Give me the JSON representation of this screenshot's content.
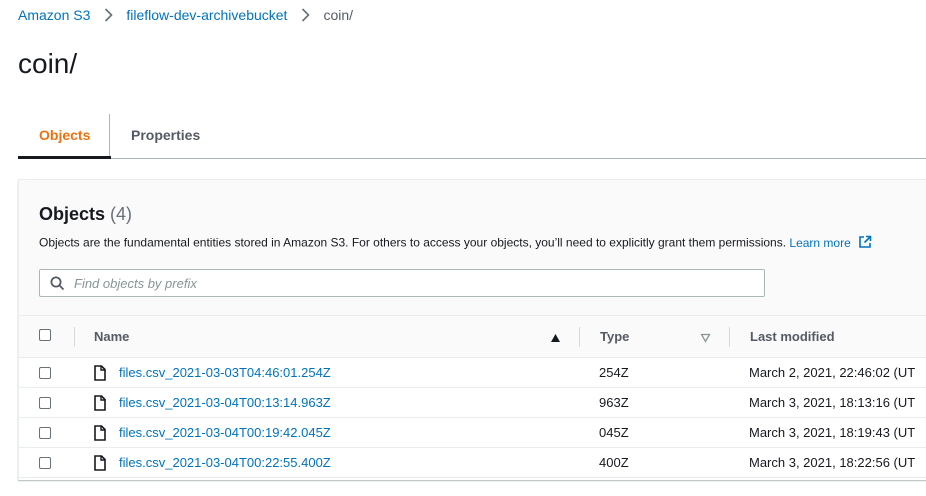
{
  "breadcrumb": {
    "items": [
      {
        "label": "Amazon S3"
      },
      {
        "label": "fileflow-dev-archivebucket"
      }
    ],
    "current": "coin/"
  },
  "page": {
    "title": "coin/"
  },
  "tabs": [
    {
      "label": "Objects",
      "active": true
    },
    {
      "label": "Properties",
      "active": false
    }
  ],
  "objects_panel": {
    "title": "Objects",
    "count": "(4)",
    "description": "Objects are the fundamental entities stored in Amazon S3. For others to access your objects, you’ll need to explicitly grant them permissions.",
    "learn_more": "Learn more",
    "search": {
      "placeholder": "Find objects by prefix",
      "value": ""
    },
    "columns": {
      "name": "Name",
      "type": "Type",
      "last_modified": "Last modified"
    },
    "rows": [
      {
        "name": "files.csv_2021-03-03T04:46:01.254Z",
        "type": "254Z",
        "last_modified": "March 2, 2021, 22:46:02 (UT"
      },
      {
        "name": "files.csv_2021-03-04T00:13:14.963Z",
        "type": "963Z",
        "last_modified": "March 3, 2021, 18:13:16 (UT"
      },
      {
        "name": "files.csv_2021-03-04T00:19:42.045Z",
        "type": "045Z",
        "last_modified": "March 3, 2021, 18:19:43 (UT"
      },
      {
        "name": "files.csv_2021-03-04T00:22:55.400Z",
        "type": "400Z",
        "last_modified": "March 3, 2021, 18:22:56 (UT"
      }
    ]
  },
  "colors": {
    "link": "#0073bb",
    "active_tab": "#ec7211",
    "text": "#16191f",
    "muted": "#545b64"
  }
}
